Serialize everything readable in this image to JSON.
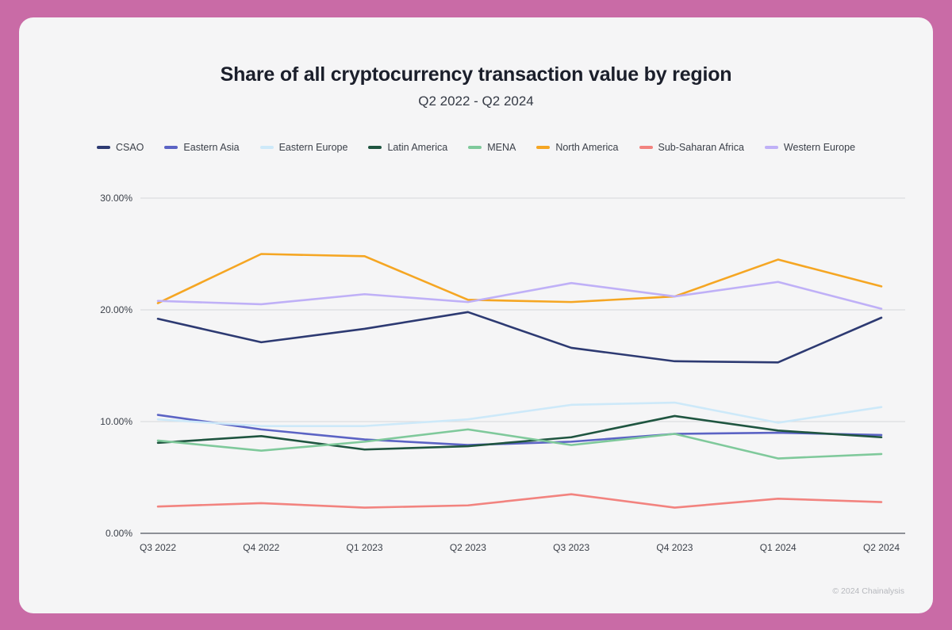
{
  "card": {
    "background": "#f5f5f6",
    "page_background": "#c96ba6"
  },
  "header": {
    "title": "Share of all cryptocurrency transaction value by region",
    "subtitle": "Q2 2022 - Q2 2024"
  },
  "footer": {
    "copyright": "© 2024 Chainalysis"
  },
  "chart_data": {
    "type": "line",
    "title": "Share of all cryptocurrency transaction value by region",
    "subtitle": "Q2 2022 - Q2 2024",
    "xlabel": "",
    "ylabel": "",
    "ylim": [
      0,
      30
    ],
    "yticks": [
      0,
      10,
      20,
      30
    ],
    "ytick_labels": [
      "0.00%",
      "10.00%",
      "20.00%",
      "30.00%"
    ],
    "grid": true,
    "legend_position": "top",
    "categories": [
      "Q3 2022",
      "Q4 2022",
      "Q1 2023",
      "Q2 2023",
      "Q3 2023",
      "Q4 2023",
      "Q1 2024",
      "Q2 2024"
    ],
    "series": [
      {
        "name": "CSAO",
        "color": "#2d3a72",
        "values": [
          19.2,
          17.1,
          18.3,
          19.8,
          16.6,
          15.4,
          15.3,
          19.3
        ]
      },
      {
        "name": "Eastern Asia",
        "color": "#5b63c4",
        "values": [
          10.6,
          9.3,
          8.4,
          7.9,
          8.2,
          8.9,
          9.0,
          8.8
        ]
      },
      {
        "name": "Eastern Europe",
        "color": "#cde9f9",
        "values": [
          10.2,
          9.6,
          9.6,
          10.2,
          11.5,
          11.7,
          9.9,
          11.3
        ]
      },
      {
        "name": "Latin America",
        "color": "#1f5540",
        "values": [
          8.1,
          8.7,
          7.5,
          7.8,
          8.6,
          10.5,
          9.2,
          8.6
        ]
      },
      {
        "name": "MENA",
        "color": "#7fc99b",
        "values": [
          8.3,
          7.4,
          8.2,
          9.3,
          7.9,
          8.9,
          6.7,
          7.1
        ]
      },
      {
        "name": "North America",
        "color": "#f5a623",
        "values": [
          20.6,
          25.0,
          24.8,
          20.9,
          20.7,
          21.2,
          24.5,
          22.1
        ]
      },
      {
        "name": "Sub-Saharan Africa",
        "color": "#f2837f",
        "values": [
          2.4,
          2.7,
          2.3,
          2.5,
          3.5,
          2.3,
          3.1,
          2.8
        ]
      },
      {
        "name": "Western Europe",
        "color": "#bfb0f7",
        "values": [
          20.8,
          20.5,
          21.4,
          20.7,
          22.4,
          21.2,
          22.5,
          20.1
        ]
      }
    ]
  }
}
